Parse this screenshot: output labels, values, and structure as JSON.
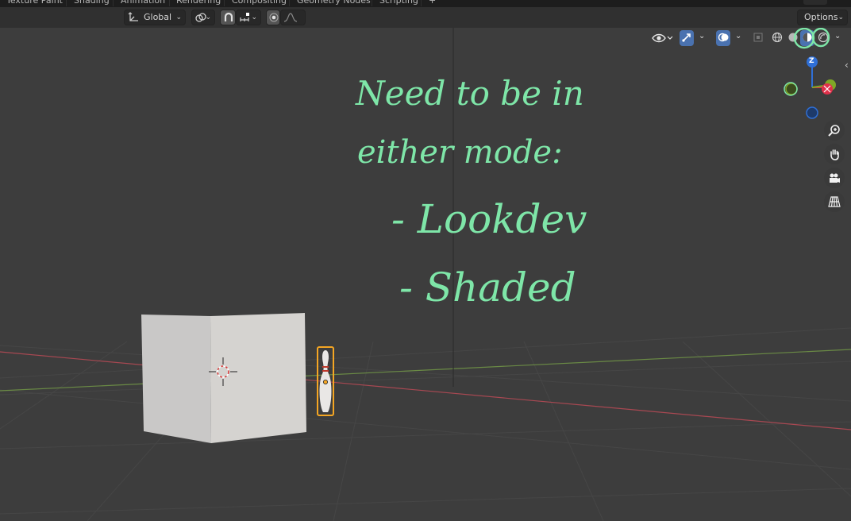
{
  "workspace_tabs": [
    {
      "label": "Texture Paint"
    },
    {
      "label": "Shading"
    },
    {
      "label": "Animation"
    },
    {
      "label": "Rendering"
    },
    {
      "label": "Compositing"
    },
    {
      "label": "Geometry Nodes"
    },
    {
      "label": "Scripting"
    },
    {
      "label": "+"
    }
  ],
  "header": {
    "orientation": {
      "value": "Global"
    },
    "options_label": "Options"
  },
  "viewport_overlays": {
    "shading_modes": [
      "wireframe",
      "solid",
      "material-preview",
      "rendered"
    ],
    "active_shading": "material-preview"
  },
  "gizmo": {
    "z_label": "Z",
    "x_color": "#e0304a",
    "y_color": "#7fa826",
    "z_color": "#2f6fd6"
  },
  "annotation": {
    "line1": "Need to be in",
    "line2": "either mode:",
    "line3": "- Lookdev",
    "line4": "- Shaded",
    "color": "#7ee6a8"
  },
  "colors": {
    "viewport_bg": "#3d3d3d",
    "selection_outline": "#f5a623"
  }
}
